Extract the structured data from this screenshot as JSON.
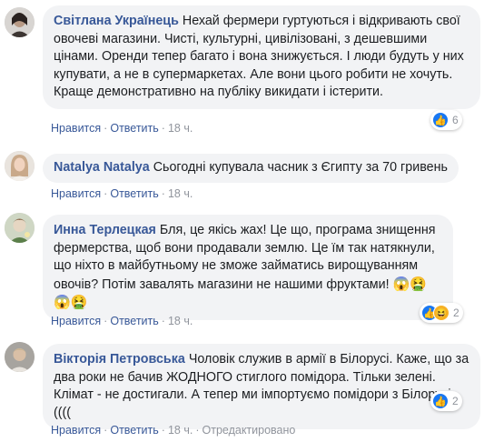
{
  "colors": {
    "author": "#385898",
    "bubble": "#f2f3f5",
    "meta": "#90949c",
    "like": "#1877f2"
  },
  "comments": [
    {
      "author": "Світлана Українець",
      "text": "Нехай фермери гуртуються і відкривають свої овочеві магазини. Чисті, культурні, цивілізовані, з дешевшими цінами. Оренди тепер багато і вона знижується. І люди будуть у них купувати, а не в супермаркетах. Але вони цього робити не хочуть. Краще демонстративно на публіку викидати і істерити.",
      "like": "Нравится",
      "reply": "Ответить",
      "time": "18 ч.",
      "reactions": {
        "icons": [
          "like-icon"
        ],
        "count": "6"
      }
    },
    {
      "author": "Natalya Natalya",
      "text": "Сьогодні купувала часник з Єгипту за 70 гривень",
      "like": "Нравится",
      "reply": "Ответить",
      "time": "18 ч."
    },
    {
      "author": "Инна Терлецкая",
      "text": "Бля, це якісь жах! Це що, програма знищення фермерства, щоб вони продавали землю. Це їм так натякнули, що ніхто в майбутньому не зможе займатись вирощуванням овочів? Потім завалять магазини не нашими фруктами!",
      "emojis": [
        "😱",
        "🤮",
        "😱",
        "🤮"
      ],
      "like": "Нравится",
      "reply": "Ответить",
      "time": "18 ч.",
      "reactions": {
        "icons": [
          "like-icon",
          "haha-icon"
        ],
        "count": "2"
      }
    },
    {
      "author": "Вікторія Петровська",
      "text": "Чоловік служив в армії в Білорусі. Каже, що за два роки не бачив ЖОДНОГО стиглого помідора. Тільки зелені. Клімат - не достигали. А тепер ми імпортуємо помідори з Білорусі ((((",
      "like": "Нравится",
      "reply": "Ответить",
      "time": "18 ч.",
      "edited": "Отредактировано",
      "reactions": {
        "icons": [
          "like-icon"
        ],
        "count": "2"
      }
    }
  ]
}
